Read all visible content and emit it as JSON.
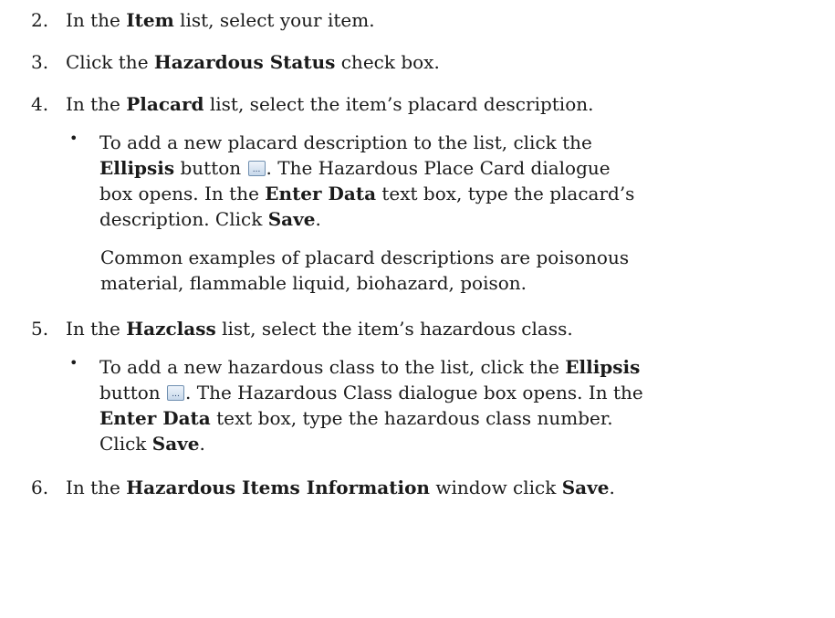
{
  "steps": [
    {
      "number": "2.",
      "pre": "In the ",
      "bold": "Item",
      "post": " list, select your item."
    },
    {
      "number": "3.",
      "pre": "Click the ",
      "bold": "Hazardous Status",
      "post": " check box."
    },
    {
      "number": "4.",
      "pre": "In the ",
      "bold": "Placard",
      "post": " list, select the item’s placard description."
    },
    {
      "number": "5.",
      "pre": "In the ",
      "bold": "Hazclass",
      "post": " list, select the item’s hazardous class."
    },
    {
      "number": "6.",
      "pre": "In the ",
      "bold": "Hazardous Items Information",
      "post": " window click ",
      "bold2": "Save",
      "post2": "."
    }
  ],
  "bullet_placard": {
    "l1_pre": "To add a new placard description to the list, click the",
    "l2_bold": "Ellipsis",
    "l2_mid": " button ",
    "l2_post": ". The Hazardous Place Card dialogue",
    "l3_pre": "box opens. In the ",
    "l3_bold": "Enter Data",
    "l3_post": " text box, type the placard’s",
    "l4_pre": "description. Click ",
    "l4_bold": "Save",
    "l4_post": "."
  },
  "note_placard": {
    "line1": "Common examples of placard descriptions are poisonous",
    "line2": "material, flammable liquid, biohazard, poison."
  },
  "bullet_hazclass": {
    "l1_pre": "To add a new hazardous class to the list, click the ",
    "l1_bold": "Ellipsis",
    "l2_pre": "button ",
    "l2_post": ". The Hazardous Class dialogue box opens. In the",
    "l3_bold": "Enter Data",
    "l3_post": " text box, type the hazardous class number.",
    "l4_pre": "Click ",
    "l4_bold": "Save",
    "l4_post": "."
  },
  "bullet_glyph": "•",
  "icons": {
    "ellipsis": "ellipsis-button-icon"
  }
}
